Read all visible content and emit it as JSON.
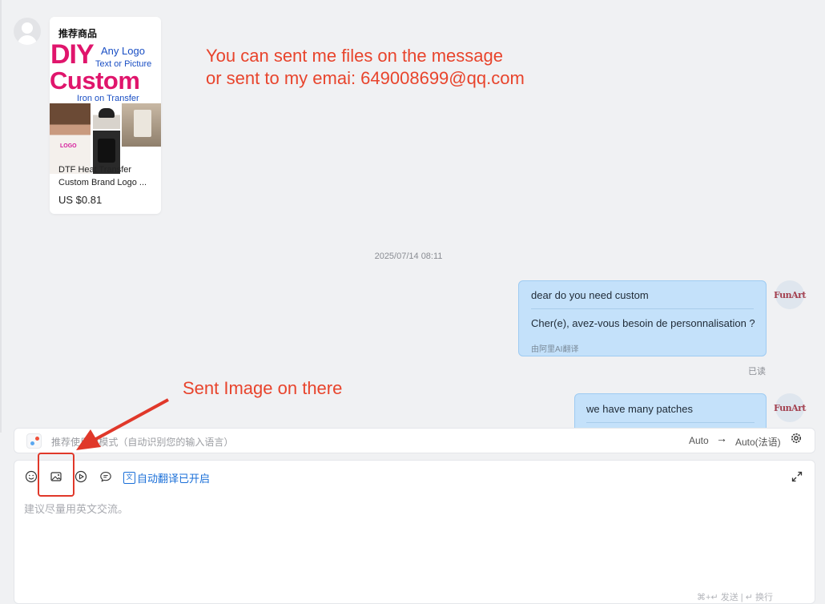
{
  "product_card": {
    "heading": "推荐商品",
    "image_text": {
      "diy": "DIY",
      "any_logo": "Any Logo",
      "text_or_picture": "Text or Picture",
      "custom": "Custom",
      "iron_on": "Iron on Transfer",
      "shirt_logo": "LOGO"
    },
    "name_line1": "DTF Heat Transfer",
    "name_line2": "Custom Brand Logo ...",
    "price": "US $0.81"
  },
  "annotations": {
    "top_line1": "You can sent me files on the message",
    "top_line2": "or sent to my emai: 649008699@qq.com",
    "bottom": "Sent Image on there"
  },
  "timestamp": "2025/07/14 08:11",
  "messages": [
    {
      "text": "dear do you need custom",
      "translation": "Cher(e), avez-vous besoin de personnalisation ?",
      "credit": "由阿里AI翻译",
      "status": "已读",
      "avatar": "FunArt"
    },
    {
      "text": "we have many patches",
      "avatar": "FunArt"
    }
  ],
  "translate_bar": {
    "hint": "推荐使用AI模式（自动识别您的输入语言）",
    "source": "Auto",
    "arrow": "→",
    "target": "Auto(法语)"
  },
  "compose": {
    "auto_translate_label": "自动翻译已开启",
    "placeholder": "建议尽量用英文交流。",
    "send_hint": "⌘+↵ 发送 | ↵ 换行"
  },
  "icons": {
    "emoji": "smile-icon",
    "image": "image-icon",
    "video": "play-icon",
    "quick_reply": "chat-bubble-icon",
    "translate": "translate-icon",
    "expand": "expand-icon",
    "settings": "gear-icon"
  },
  "colors": {
    "annotation": "#e8442c",
    "bubble": "#c4e1fa",
    "link_blue": "#1a6fd8",
    "brand_pink": "#e0156c"
  }
}
